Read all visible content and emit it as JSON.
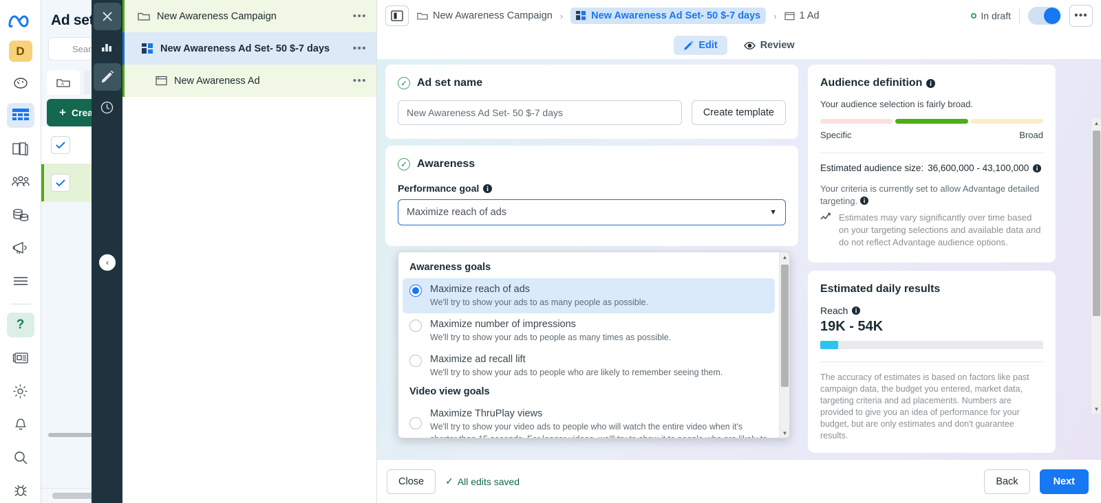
{
  "rail": {
    "logo": "meta-logo",
    "avatar": "D",
    "items": [
      {
        "name": "speedometer-icon"
      },
      {
        "name": "table-icon"
      },
      {
        "name": "books-icon"
      },
      {
        "name": "people-icon"
      },
      {
        "name": "coins-icon"
      },
      {
        "name": "megaphone-icon"
      },
      {
        "name": "menu-icon"
      }
    ],
    "bottom": [
      {
        "name": "help-icon",
        "glyph": "?"
      },
      {
        "name": "news-icon"
      },
      {
        "name": "gear-icon"
      },
      {
        "name": "bell-icon"
      },
      {
        "name": "search-icon"
      },
      {
        "name": "bug-icon"
      }
    ]
  },
  "left_panel": {
    "title": "Ad sets",
    "search_placeholder": "Search",
    "create_label": "Create"
  },
  "dark_rail": {
    "items": [
      {
        "name": "close-icon",
        "label": "Close"
      },
      {
        "name": "chart-icon",
        "label": "Charts"
      },
      {
        "name": "edit-pencil-icon",
        "label": "Edit"
      },
      {
        "name": "history-clock-icon",
        "label": "History"
      }
    ],
    "collapse_label": "‹"
  },
  "tree": {
    "rows": [
      {
        "label": "New Awareness Campaign",
        "icon": "folder-icon",
        "level": "campaign",
        "menu": "•••"
      },
      {
        "label": "New Awareness Ad Set- 50 $-7 days",
        "icon": "adset-grid-icon",
        "level": "adset",
        "menu": "•••"
      },
      {
        "label": "New Awareness Ad",
        "icon": "ad-window-icon",
        "level": "ad",
        "menu": "•••"
      }
    ]
  },
  "topbar": {
    "panel_toggle": "side-panel-icon",
    "breadcrumb": [
      {
        "label": "New Awareness Campaign",
        "icon": "folder-icon"
      },
      {
        "label": "New Awareness Ad Set- 50 $-7 days",
        "icon": "adset-grid-icon",
        "active": true
      },
      {
        "label": "1 Ad",
        "icon": "ad-window-icon"
      }
    ],
    "separator": "›",
    "status": "In draft",
    "more": "•••"
  },
  "tabs": [
    {
      "label": "Edit",
      "icon": "pencil-icon",
      "active": true
    },
    {
      "label": "Review",
      "icon": "eye-icon",
      "active": false
    }
  ],
  "ad_set_name": {
    "heading": "Ad set name",
    "value": "New Awareness Ad Set- 50 $-7 days",
    "create_template": "Create template"
  },
  "awareness": {
    "heading": "Awareness",
    "performance_goal_label": "Performance goal",
    "performance_goal_value": "Maximize reach of ads",
    "info": "ℹ"
  },
  "dropdown": {
    "groups": [
      {
        "title": "Awareness goals",
        "options": [
          {
            "title": "Maximize reach of ads",
            "desc": "We'll try to show your ads to as many people as possible.",
            "selected": true
          },
          {
            "title": "Maximize number of impressions",
            "desc": "We'll try to show your ads to people as many times as possible.",
            "selected": false
          },
          {
            "title": "Maximize ad recall lift",
            "desc": "We'll try to show your ads to people who are likely to remember seeing them.",
            "selected": false
          }
        ]
      },
      {
        "title": "Video view goals",
        "options": [
          {
            "title": "Maximize ThruPlay views",
            "desc": "We'll try to show your video ads to people who will watch the entire video when it's shorter than 15 seconds. For longer videos, we'll try to show it to people who are likely to",
            "selected": false
          }
        ]
      }
    ]
  },
  "audience": {
    "title": "Audience definition",
    "subtitle": "Your audience selection is fairly broad.",
    "meter_colors": [
      "#fbe0dd",
      "#4caf17",
      "#fbedc4"
    ],
    "label_left": "Specific",
    "label_right": "Broad",
    "size_label": "Estimated audience size:",
    "size_value": "36,600,000 - 43,100,000",
    "criteria": "Your criteria is currently set to allow Advantage detailed targeting.",
    "note": "Estimates may vary significantly over time based on your targeting selections and available data and do not reflect Advantage audience options."
  },
  "daily_results": {
    "title": "Estimated daily results",
    "reach_label": "Reach",
    "reach_value": "19K - 54K",
    "reach_fill_pct": 8,
    "disclaimer": "The accuracy of estimates is based on factors like past campaign data, the budget you entered, market data, targeting criteria and ad placements. Numbers are provided to give you an idea of performance for your budget, but are only estimates and don't guarantee results."
  },
  "footer": {
    "close": "Close",
    "saved": "All edits saved",
    "back": "Back",
    "next": "Next"
  },
  "colors": {
    "accent_blue": "#1877f2",
    "green": "#31a24c",
    "dark_rail": "#1e333d"
  }
}
